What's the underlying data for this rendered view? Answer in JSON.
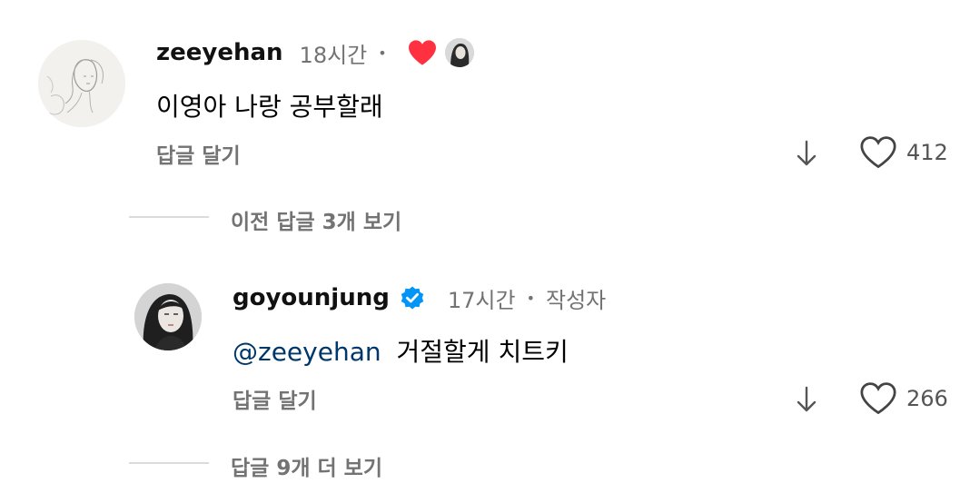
{
  "comments": [
    {
      "username": "zeeyehan",
      "time": "18시간",
      "dot": "•",
      "text": "이영아 나랑 공부할래",
      "reply_label": "답글 달기",
      "likes": "412",
      "creator_liked": true
    },
    {
      "username": "goyounjung",
      "verified": true,
      "time": "17시간",
      "dot": "•",
      "author_label": "작성자",
      "mention": "@zeeyehan",
      "text": "거절할게 치트키",
      "reply_label": "답글 달기",
      "likes": "266"
    }
  ],
  "view_previous": "이전 답글 3개 보기",
  "view_more": "답글 9개 더 보기",
  "colors": {
    "heart_red": "#ff3040",
    "verified_blue": "#0095f6",
    "mention": "#00376b",
    "meta": "#737373"
  },
  "icons": {
    "liked": "heart-filled-icon",
    "like": "heart-outline-icon",
    "translate": "arrow-down-icon",
    "verified": "verified-badge-icon"
  }
}
